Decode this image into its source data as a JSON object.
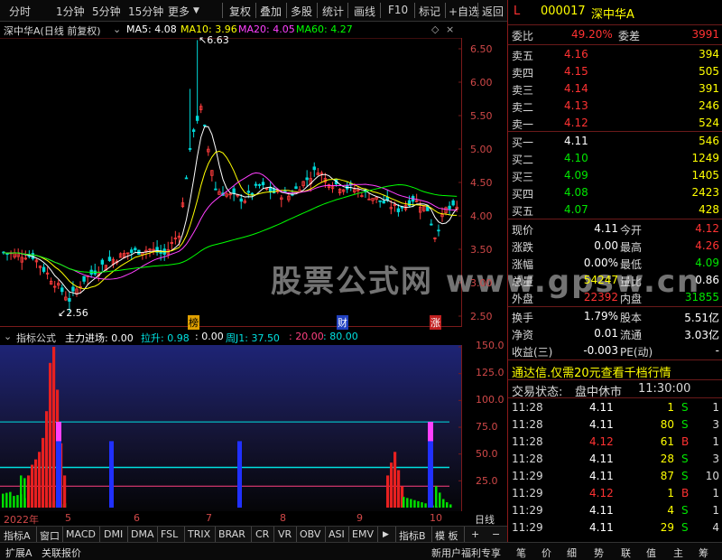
{
  "toolbar": {
    "items": [
      "分时",
      "1分钟",
      "5分钟",
      "15分钟",
      "更多",
      "复权",
      "叠加",
      "多股",
      "统计",
      "画线",
      "F10",
      "标记",
      "+自选",
      "返回"
    ]
  },
  "legend": {
    "title": "深中华A(日线 前复权)",
    "ma5": "MA5: 4.08",
    "ma10": "MA10: 3.96",
    "ma20": "MA20: 4.05",
    "ma60": "MA60: 4.27"
  },
  "price_axis": [
    "6.50",
    "6.00",
    "5.50",
    "5.00",
    "4.50",
    "4.00",
    "3.50",
    "3.00",
    "2.50"
  ],
  "annotations": {
    "high": "6.63",
    "low": "2.56",
    "mark1": "榜",
    "mark2": "财",
    "mark3": "涨"
  },
  "indicator": {
    "name": "指标公式",
    "main": "主力进场: 0.00",
    "pull": "拉升: 0.98",
    "zero": ": 0.00",
    "week": "周J1: 37.50",
    "v20": ": 20.00",
    "v80": ": 80.00"
  },
  "ind_axis": [
    "150.0",
    "125.0",
    "100.0",
    "75.0",
    "50.0",
    "25.0"
  ],
  "date_axis": [
    "2022年",
    "5",
    "6",
    "7",
    "8",
    "9",
    "10"
  ],
  "date_axis_right": "日线",
  "tabs": [
    "指标A",
    "窗口",
    "MACD",
    "DMI",
    "DMA",
    "FSL",
    "TRIX",
    "BRAR",
    "CR",
    "VR",
    "OBV",
    "ASI",
    "EMV",
    "▶",
    "指标B",
    "模 板",
    "+",
    "−"
  ],
  "bottom": {
    "left1": "扩展A",
    "left2": "关联报价",
    "promo": "新用户福利专享",
    "tabs": [
      "笔",
      "价",
      "细",
      "势",
      "联",
      "值",
      "主",
      "筹"
    ]
  },
  "watermark": "股票公式网  www.gpsw.cn",
  "stock": {
    "flag": "L",
    "code": "000017",
    "name": "深中华A"
  },
  "weibi": {
    "label1": "委比",
    "value1": "49.20%",
    "label2": "委差",
    "value2": "3991"
  },
  "asks": [
    {
      "label": "卖五",
      "price": "4.16",
      "vol": "394"
    },
    {
      "label": "卖四",
      "price": "4.15",
      "vol": "505"
    },
    {
      "label": "卖三",
      "price": "4.14",
      "vol": "391"
    },
    {
      "label": "卖二",
      "price": "4.13",
      "vol": "246"
    },
    {
      "label": "卖一",
      "price": "4.12",
      "vol": "524"
    }
  ],
  "bids": [
    {
      "label": "买一",
      "price": "4.11",
      "vol": "546"
    },
    {
      "label": "买二",
      "price": "4.10",
      "vol": "1249"
    },
    {
      "label": "买三",
      "price": "4.09",
      "vol": "1405"
    },
    {
      "label": "买四",
      "price": "4.08",
      "vol": "2423"
    },
    {
      "label": "买五",
      "price": "4.07",
      "vol": "428"
    }
  ],
  "quote": [
    {
      "l1": "现价",
      "v1": "4.11",
      "l2": "今开",
      "v2": "4.12"
    },
    {
      "l1": "涨跌",
      "v1": "0.00",
      "l2": "最高",
      "v2": "4.26"
    },
    {
      "l1": "涨幅",
      "v1": "0.00%",
      "l2": "最低",
      "v2": "4.09"
    },
    {
      "l1": "总量",
      "v1": "54247",
      "l2": "量比",
      "v2": "0.86"
    },
    {
      "l1": "外盘",
      "v1": "22392",
      "l2": "内盘",
      "v2": "31855"
    }
  ],
  "quote2": [
    {
      "l1": "换手",
      "v1": "1.79%",
      "l2": "股本",
      "v2": "5.51亿"
    },
    {
      "l1": "净资",
      "v1": "0.01",
      "l2": "流通",
      "v2": "3.03亿"
    },
    {
      "l1": "收益(三)",
      "v1": "-0.003",
      "l2": "PE(动)",
      "v2": "-"
    }
  ],
  "notice": "通达信.仅需20元查看千档行情",
  "status": {
    "label": "交易状态:",
    "value": "盘中休市",
    "time": "11:30:00"
  },
  "ticks": [
    {
      "t": "11:28",
      "p": "4.11",
      "v": "1",
      "d": "S",
      "n": "1"
    },
    {
      "t": "11:28",
      "p": "4.11",
      "v": "80",
      "d": "S",
      "n": "3"
    },
    {
      "t": "11:28",
      "p": "4.12",
      "v": "61",
      "d": "B",
      "n": "1"
    },
    {
      "t": "11:28",
      "p": "4.11",
      "v": "28",
      "d": "S",
      "n": "3"
    },
    {
      "t": "11:29",
      "p": "4.11",
      "v": "87",
      "d": "S",
      "n": "10"
    },
    {
      "t": "11:29",
      "p": "4.12",
      "v": "1",
      "d": "B",
      "n": "1"
    },
    {
      "t": "11:29",
      "p": "4.11",
      "v": "4",
      "d": "S",
      "n": "1"
    },
    {
      "t": "11:29",
      "p": "4.11",
      "v": "29",
      "d": "S",
      "n": "4"
    }
  ],
  "colors": {
    "up": "#ff3232",
    "down": "#00e600",
    "ma5": "#ffffff",
    "ma10": "#ffff00",
    "ma20": "#ff40ff",
    "ma60": "#00ff00",
    "accent": "#00e0e0"
  }
}
